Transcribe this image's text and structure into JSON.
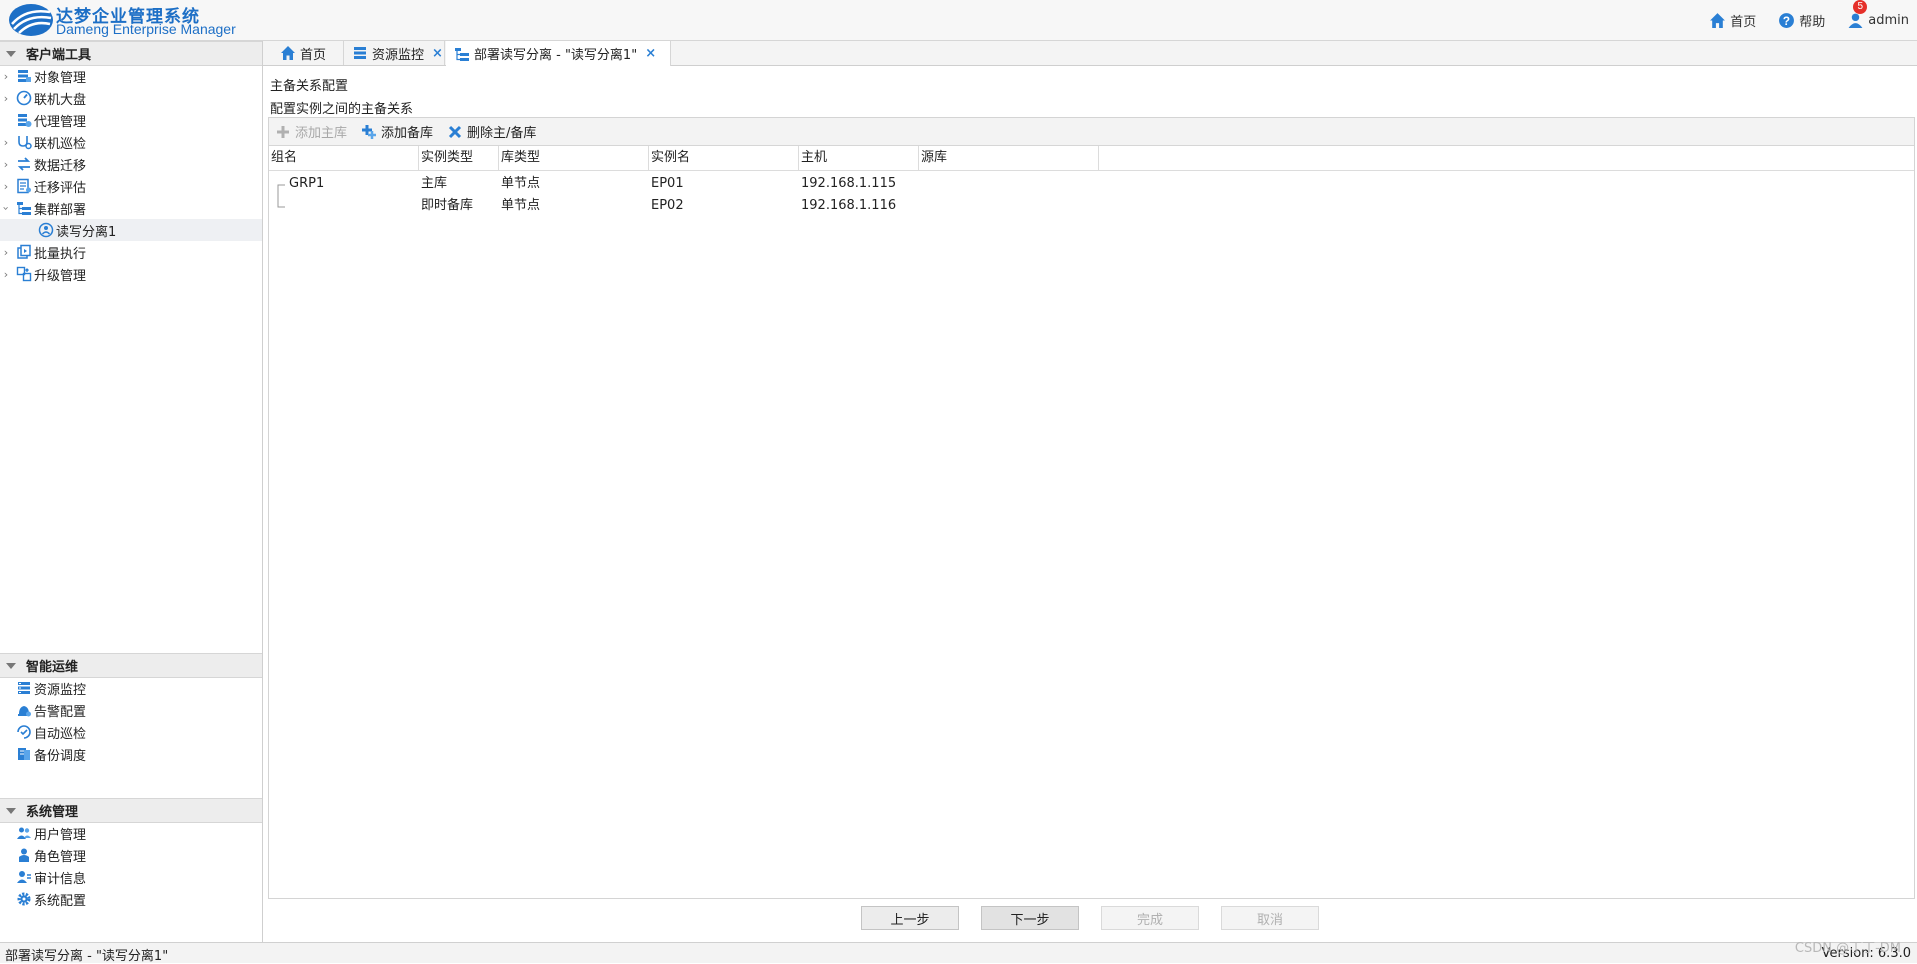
{
  "header": {
    "brand_cn": "达梦企业管理系统",
    "brand_en": "Dameng Enterprise Manager",
    "home": "首页",
    "help": "帮助",
    "user": "admin",
    "notifications": "5",
    "accent": "#1d6fc6"
  },
  "sidebar": {
    "client_tools": {
      "title": "客户端工具",
      "items": [
        {
          "label": "对象管理",
          "icon": "object-icon"
        },
        {
          "label": "联机大盘",
          "icon": "dashboard-icon"
        },
        {
          "label": "代理管理",
          "icon": "agent-icon"
        },
        {
          "label": "联机巡检",
          "icon": "inspect-icon"
        },
        {
          "label": "数据迁移",
          "icon": "migrate-icon"
        },
        {
          "label": "迁移评估",
          "icon": "assess-icon"
        },
        {
          "label": "集群部署",
          "icon": "cluster-icon"
        },
        {
          "label": "读写分离1",
          "icon": "rw-split-icon"
        },
        {
          "label": "批量执行",
          "icon": "batch-icon"
        },
        {
          "label": "升级管理",
          "icon": "upgrade-icon"
        }
      ]
    },
    "ops": {
      "title": "智能运维",
      "items": [
        {
          "label": "资源监控"
        },
        {
          "label": "告警配置"
        },
        {
          "label": "自动巡检"
        },
        {
          "label": "备份调度"
        }
      ]
    },
    "system": {
      "title": "系统管理",
      "items": [
        {
          "label": "用户管理"
        },
        {
          "label": "角色管理"
        },
        {
          "label": "审计信息"
        },
        {
          "label": "系统配置"
        }
      ]
    }
  },
  "tabs": [
    {
      "label": "首页"
    },
    {
      "label": "资源监控"
    },
    {
      "label": "部署读写分离 - \"读写分离1\""
    }
  ],
  "main": {
    "title": "主备关系配置",
    "subtitle": "配置实例之间的主备关系",
    "toolbar": {
      "add_primary": "添加主库",
      "add_standby": "添加备库",
      "delete": "删除主/备库"
    },
    "columns": [
      "组名",
      "实例类型",
      "库类型",
      "实例名",
      "主机",
      "源库"
    ],
    "rows": [
      {
        "group": "GRP1",
        "inst_type": "主库",
        "db_type": "单节点",
        "name": "EP01",
        "host": "192.168.1.115",
        "source": ""
      },
      {
        "group": "",
        "inst_type": "即时备库",
        "db_type": "单节点",
        "name": "EP02",
        "host": "192.168.1.116",
        "source": ""
      }
    ],
    "buttons": {
      "prev": "上一步",
      "next": "下一步",
      "finish": "完成",
      "cancel": "取消"
    }
  },
  "status": {
    "left": "部署读写分离 - \"读写分离1\"",
    "version": "Version: 6.3.0",
    "watermark": "CSDN @丁丁-DM"
  }
}
